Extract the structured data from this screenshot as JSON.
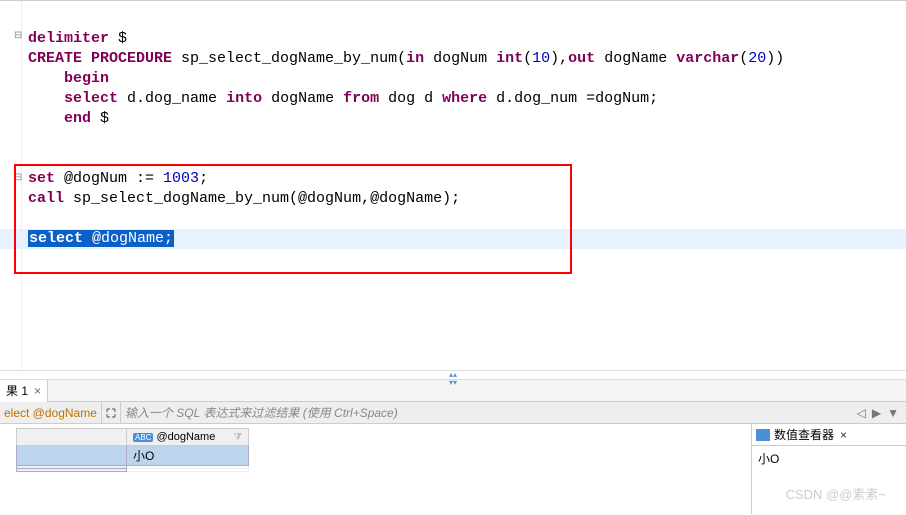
{
  "code": {
    "l1_kw": "delimiter",
    "l1_sym": " $",
    "l2_kw1": "CREATE PROCEDURE",
    "l2_id": " sp_select_dogName_by_num(",
    "l2_kw2": "in",
    "l2_p1": " dogNum ",
    "l2_dt1": "int",
    "l2_p1n": "(",
    "l2_n1": "10",
    "l2_p1c": "),",
    "l2_kw3": "out",
    "l2_p2": " dogName ",
    "l2_dt2": "varchar",
    "l2_p2n": "(",
    "l2_n2": "20",
    "l2_p2c": "))",
    "l3_kw": "begin",
    "l4_kw1": "select",
    "l4_t1": " d.dog_name ",
    "l4_kw2": "into",
    "l4_t2": " dogName ",
    "l4_kw3": "from",
    "l4_t3": " dog d ",
    "l4_kw4": "where",
    "l4_t4": " d.dog_num =dogNum;",
    "l5_kw": "end",
    "l5_sym": " $",
    "l8_kw": "set",
    "l8_t1": " @dogNum := ",
    "l8_n": "1003",
    "l8_t2": ";",
    "l9_kw": "call",
    "l9_t": " sp_select_dogName_by_num(@dogNum,@dogName);",
    "l11_kw": "select",
    "l11_t": " @dogName;"
  },
  "tabs": {
    "result_label": "果 1",
    "close": "×"
  },
  "filter": {
    "query": "elect @dogName",
    "hint": "输入一个 SQL 表达式来过滤结果 (使用 Ctrl+Space)",
    "nav_left": "◁",
    "nav_right": "▶",
    "nav_down": "▼"
  },
  "grid": {
    "type_badge": "ABC",
    "col_header": "@dogName",
    "filter_glyph": "⧩",
    "row1_value": "小O"
  },
  "viewer": {
    "title": "数值查看器",
    "close": "×",
    "value": "小O"
  },
  "watermark": "CSDN @@素素~"
}
